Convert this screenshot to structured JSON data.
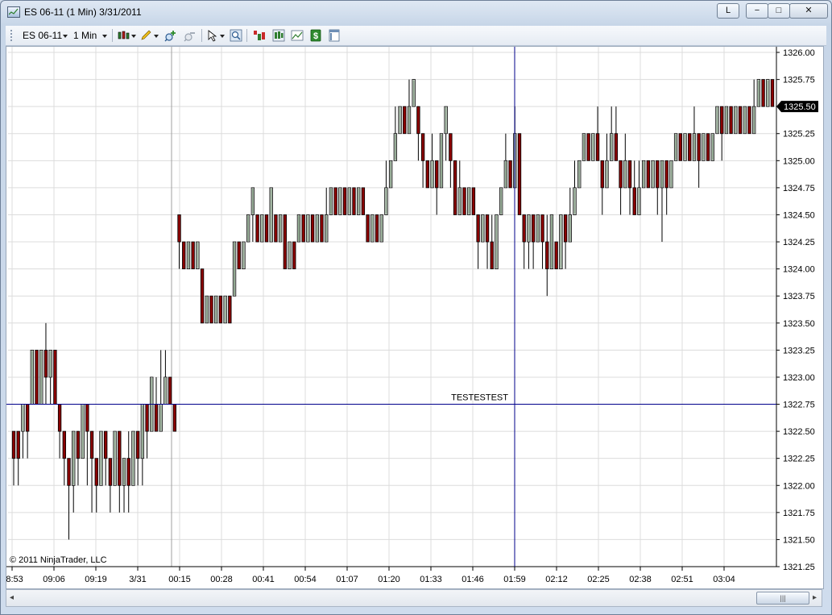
{
  "window": {
    "title": "ES 06-11 (1 Min)  3/31/2011",
    "layout_button": "L",
    "minimize_glyph": "−",
    "maximize_glyph": "□",
    "close_glyph": "✕"
  },
  "toolbar": {
    "instrument": "ES 06-11",
    "interval": "1 Min",
    "icons": [
      "bar-type-icon",
      "pencil-draw-icon",
      "zoom-in-icon",
      "zoom-out-icon",
      "pointer-icon",
      "magnifier-icon",
      "indicators-icon",
      "strategies-icon",
      "chart-style-icon",
      "dollar-icon",
      "properties-icon"
    ]
  },
  "copyright": "© 2011 NinjaTrader, LLC",
  "crosshair_label": "TESTESTEST",
  "price_badge": "1325.50",
  "colors": {
    "up": "#2f5b2f",
    "down": "#8b0000",
    "wick": "#000000",
    "crosshair": "#00008b",
    "grid": "#dcdcdc"
  },
  "scrollbar": {
    "left_arrow": "◂",
    "right_arrow": "▸",
    "thumb_grip": "|||"
  },
  "chart_data": {
    "type": "candlestick",
    "y_ticks": [
      "1326.00",
      "1325.75",
      "1325.50",
      "1325.25",
      "1325.00",
      "1324.75",
      "1324.50",
      "1324.25",
      "1324.00",
      "1323.75",
      "1323.50",
      "1323.25",
      "1323.00",
      "1322.75",
      "1322.50",
      "1322.25",
      "1322.00",
      "1321.75",
      "1321.50",
      "1321.25"
    ],
    "ylim": [
      1321.25,
      1326.0
    ],
    "x_ticks": [
      "08:53",
      "09:06",
      "09:19",
      "3/31",
      "00:15",
      "00:28",
      "00:41",
      "00:54",
      "01:07",
      "01:20",
      "01:33",
      "01:46",
      "01:59",
      "02:12",
      "02:25",
      "02:38",
      "02:51",
      "03:04"
    ],
    "crosshair": {
      "x_time": "01:59",
      "y_price": 1322.75
    },
    "last_price": 1325.5,
    "bars": [
      [
        1322.5,
        1322.25,
        1322.5,
        1322.0
      ],
      [
        1322.5,
        1322.25,
        1322.5,
        1322.0
      ],
      [
        1322.5,
        1322.75,
        1322.75,
        1322.25
      ],
      [
        1322.75,
        1322.5,
        1322.75,
        1322.25
      ],
      [
        1322.75,
        1323.25,
        1323.25,
        1322.75
      ],
      [
        1323.25,
        1322.75,
        1323.25,
        1322.75
      ],
      [
        1322.75,
        1323.25,
        1323.25,
        1322.75
      ],
      [
        1323.25,
        1323.0,
        1323.5,
        1322.75
      ],
      [
        1323.0,
        1323.25,
        1323.25,
        1322.75
      ],
      [
        1323.25,
        1322.75,
        1323.25,
        1322.75
      ],
      [
        1322.75,
        1322.5,
        1322.75,
        1322.25
      ],
      [
        1322.5,
        1322.25,
        1322.5,
        1322.0
      ],
      [
        1322.25,
        1322.0,
        1322.25,
        1321.5
      ],
      [
        1322.0,
        1322.5,
        1322.5,
        1321.75
      ],
      [
        1322.5,
        1322.25,
        1322.5,
        1322.0
      ],
      [
        1322.25,
        1322.75,
        1322.75,
        1322.25
      ],
      [
        1322.75,
        1322.5,
        1322.75,
        1322.0
      ],
      [
        1322.5,
        1322.25,
        1322.5,
        1321.75
      ],
      [
        1322.25,
        1322.0,
        1322.25,
        1321.75
      ],
      [
        1322.0,
        1322.5,
        1322.5,
        1322.0
      ],
      [
        1322.5,
        1322.25,
        1322.5,
        1322.0
      ],
      [
        1322.25,
        1322.0,
        1322.25,
        1321.75
      ],
      [
        1322.0,
        1322.5,
        1322.5,
        1322.0
      ],
      [
        1322.5,
        1322.0,
        1322.5,
        1321.75
      ],
      [
        1322.0,
        1322.25,
        1322.25,
        1321.75
      ],
      [
        1322.25,
        1322.0,
        1322.5,
        1321.75
      ],
      [
        1322.0,
        1322.5,
        1322.5,
        1322.0
      ],
      [
        1322.5,
        1322.25,
        1322.5,
        1322.0
      ],
      [
        1322.25,
        1322.75,
        1322.75,
        1322.0
      ],
      [
        1322.75,
        1322.5,
        1322.75,
        1322.25
      ],
      [
        1322.5,
        1323.0,
        1323.0,
        1322.5
      ],
      [
        1322.75,
        1322.5,
        1323.0,
        1322.5
      ],
      [
        1322.5,
        1322.75,
        1323.25,
        1322.5
      ],
      [
        1322.75,
        1323.0,
        1323.25,
        1322.75
      ],
      [
        1323.0,
        1322.75,
        1323.0,
        1322.75
      ],
      [
        1322.75,
        1322.5,
        1322.75,
        1322.5
      ],
      [
        1324.5,
        1324.25,
        1324.5,
        1324.0
      ],
      [
        1324.25,
        1324.0,
        1324.25,
        1324.0
      ],
      [
        1324.0,
        1324.25,
        1324.25,
        1324.0
      ],
      [
        1324.25,
        1324.0,
        1324.25,
        1324.0
      ],
      [
        1324.0,
        1324.25,
        1324.25,
        1324.0
      ],
      [
        1324.0,
        1323.5,
        1324.0,
        1323.5
      ],
      [
        1323.5,
        1323.75,
        1323.75,
        1323.5
      ],
      [
        1323.75,
        1323.5,
        1323.75,
        1323.5
      ],
      [
        1323.5,
        1323.75,
        1323.75,
        1323.5
      ],
      [
        1323.75,
        1323.5,
        1323.75,
        1323.5
      ],
      [
        1323.5,
        1323.75,
        1323.75,
        1323.5
      ],
      [
        1323.75,
        1323.5,
        1323.75,
        1323.5
      ],
      [
        1323.75,
        1324.25,
        1324.25,
        1323.75
      ],
      [
        1324.25,
        1324.0,
        1324.25,
        1324.0
      ],
      [
        1324.0,
        1324.25,
        1324.25,
        1324.0
      ],
      [
        1324.25,
        1324.5,
        1324.5,
        1324.25
      ],
      [
        1324.5,
        1324.75,
        1324.75,
        1324.25
      ],
      [
        1324.5,
        1324.25,
        1324.5,
        1324.25
      ],
      [
        1324.25,
        1324.5,
        1324.5,
        1324.25
      ],
      [
        1324.5,
        1324.25,
        1324.5,
        1324.25
      ],
      [
        1324.25,
        1324.75,
        1324.75,
        1324.25
      ],
      [
        1324.5,
        1324.25,
        1324.5,
        1324.25
      ],
      [
        1324.25,
        1324.5,
        1324.5,
        1324.25
      ],
      [
        1324.5,
        1324.0,
        1324.5,
        1324.0
      ],
      [
        1324.0,
        1324.25,
        1324.25,
        1324.0
      ],
      [
        1324.25,
        1324.0,
        1324.25,
        1324.0
      ],
      [
        1324.25,
        1324.5,
        1324.5,
        1324.25
      ],
      [
        1324.5,
        1324.25,
        1324.5,
        1324.25
      ],
      [
        1324.25,
        1324.5,
        1324.5,
        1324.25
      ],
      [
        1324.5,
        1324.25,
        1324.5,
        1324.25
      ],
      [
        1324.25,
        1324.5,
        1324.5,
        1324.25
      ],
      [
        1324.5,
        1324.25,
        1324.5,
        1324.25
      ],
      [
        1324.25,
        1324.5,
        1324.75,
        1324.25
      ],
      [
        1324.5,
        1324.75,
        1324.75,
        1324.5
      ],
      [
        1324.75,
        1324.5,
        1324.75,
        1324.5
      ],
      [
        1324.5,
        1324.75,
        1324.75,
        1324.5
      ],
      [
        1324.75,
        1324.5,
        1324.75,
        1324.5
      ],
      [
        1324.5,
        1324.75,
        1324.75,
        1324.5
      ],
      [
        1324.75,
        1324.5,
        1324.75,
        1324.5
      ],
      [
        1324.5,
        1324.75,
        1324.75,
        1324.5
      ],
      [
        1324.75,
        1324.5,
        1324.75,
        1324.5
      ],
      [
        1324.5,
        1324.25,
        1324.5,
        1324.25
      ],
      [
        1324.25,
        1324.5,
        1324.5,
        1324.25
      ],
      [
        1324.5,
        1324.25,
        1324.5,
        1324.25
      ],
      [
        1324.25,
        1324.5,
        1324.5,
        1324.25
      ],
      [
        1324.5,
        1324.75,
        1325.0,
        1324.5
      ],
      [
        1324.75,
        1325.0,
        1325.0,
        1324.75
      ],
      [
        1325.0,
        1325.25,
        1325.5,
        1325.0
      ],
      [
        1325.25,
        1325.5,
        1325.5,
        1325.25
      ],
      [
        1325.5,
        1325.25,
        1325.5,
        1325.25
      ],
      [
        1325.25,
        1325.5,
        1325.75,
        1325.25
      ],
      [
        1325.5,
        1325.75,
        1325.75,
        1325.5
      ],
      [
        1325.5,
        1325.25,
        1325.5,
        1325.0
      ],
      [
        1325.25,
        1325.0,
        1325.25,
        1324.75
      ],
      [
        1325.0,
        1324.75,
        1325.0,
        1324.75
      ],
      [
        1324.75,
        1325.0,
        1325.25,
        1324.75
      ],
      [
        1325.0,
        1324.75,
        1325.0,
        1324.5
      ],
      [
        1324.75,
        1325.25,
        1325.25,
        1324.75
      ],
      [
        1325.25,
        1325.5,
        1325.5,
        1325.0
      ],
      [
        1325.25,
        1325.0,
        1325.25,
        1324.75
      ],
      [
        1325.0,
        1324.5,
        1325.0,
        1324.5
      ],
      [
        1324.5,
        1324.75,
        1325.0,
        1324.5
      ],
      [
        1324.75,
        1324.5,
        1324.75,
        1324.5
      ],
      [
        1324.5,
        1324.75,
        1324.75,
        1324.5
      ],
      [
        1324.75,
        1324.5,
        1324.75,
        1324.5
      ],
      [
        1324.5,
        1324.25,
        1324.5,
        1324.0
      ],
      [
        1324.25,
        1324.5,
        1324.5,
        1324.25
      ],
      [
        1324.5,
        1324.25,
        1324.5,
        1324.0
      ],
      [
        1324.25,
        1324.0,
        1324.5,
        1324.0
      ],
      [
        1324.0,
        1324.5,
        1324.5,
        1324.0
      ],
      [
        1324.5,
        1324.75,
        1324.75,
        1324.5
      ],
      [
        1324.75,
        1325.0,
        1325.25,
        1324.75
      ],
      [
        1325.0,
        1324.75,
        1325.0,
        1324.75
      ],
      [
        1324.75,
        1325.25,
        1325.5,
        1324.75
      ],
      [
        1325.25,
        1324.5,
        1325.25,
        1324.5
      ],
      [
        1324.5,
        1324.25,
        1324.5,
        1324.0
      ],
      [
        1324.25,
        1324.5,
        1324.5,
        1324.0
      ],
      [
        1324.5,
        1324.25,
        1324.5,
        1324.0
      ],
      [
        1324.25,
        1324.5,
        1324.5,
        1324.25
      ],
      [
        1324.5,
        1324.25,
        1324.5,
        1324.0
      ],
      [
        1324.25,
        1324.0,
        1324.5,
        1323.75
      ],
      [
        1324.0,
        1324.5,
        1324.5,
        1324.0
      ],
      [
        1324.25,
        1324.0,
        1324.25,
        1324.0
      ],
      [
        1324.0,
        1324.5,
        1324.5,
        1324.0
      ],
      [
        1324.5,
        1324.25,
        1324.5,
        1324.0
      ],
      [
        1324.25,
        1324.5,
        1324.75,
        1324.25
      ],
      [
        1324.5,
        1324.75,
        1325.0,
        1324.5
      ],
      [
        1324.75,
        1325.0,
        1325.0,
        1324.75
      ],
      [
        1325.0,
        1325.25,
        1325.25,
        1325.0
      ],
      [
        1325.25,
        1325.0,
        1325.25,
        1325.0
      ],
      [
        1325.0,
        1325.25,
        1325.25,
        1325.0
      ],
      [
        1325.25,
        1325.0,
        1325.5,
        1325.0
      ],
      [
        1325.0,
        1324.75,
        1325.0,
        1324.5
      ],
      [
        1324.75,
        1325.0,
        1325.25,
        1324.75
      ],
      [
        1325.0,
        1325.25,
        1325.5,
        1325.0
      ],
      [
        1325.25,
        1325.0,
        1325.5,
        1325.0
      ],
      [
        1325.0,
        1324.75,
        1325.0,
        1324.5
      ],
      [
        1324.75,
        1325.0,
        1325.25,
        1324.75
      ],
      [
        1325.0,
        1324.75,
        1325.0,
        1324.5
      ],
      [
        1324.75,
        1324.5,
        1325.0,
        1324.5
      ],
      [
        1324.5,
        1324.75,
        1325.0,
        1324.5
      ],
      [
        1324.75,
        1325.0,
        1325.0,
        1324.75
      ],
      [
        1325.0,
        1324.75,
        1325.0,
        1324.75
      ],
      [
        1324.75,
        1325.0,
        1325.0,
        1324.75
      ],
      [
        1325.0,
        1324.75,
        1325.0,
        1324.5
      ],
      [
        1324.75,
        1325.0,
        1325.0,
        1324.25
      ],
      [
        1325.0,
        1324.75,
        1325.0,
        1324.5
      ],
      [
        1324.75,
        1325.0,
        1325.0,
        1324.75
      ],
      [
        1325.0,
        1325.25,
        1325.25,
        1325.0
      ],
      [
        1325.25,
        1325.0,
        1325.25,
        1325.0
      ],
      [
        1325.0,
        1325.25,
        1325.25,
        1325.0
      ],
      [
        1325.25,
        1325.0,
        1325.25,
        1325.0
      ],
      [
        1325.0,
        1325.25,
        1325.5,
        1325.0
      ],
      [
        1325.25,
        1325.0,
        1325.25,
        1324.75
      ],
      [
        1325.0,
        1325.25,
        1325.25,
        1325.0
      ],
      [
        1325.25,
        1325.0,
        1325.25,
        1325.0
      ],
      [
        1325.0,
        1325.25,
        1325.25,
        1325.0
      ],
      [
        1325.25,
        1325.5,
        1325.5,
        1325.25
      ],
      [
        1325.5,
        1325.25,
        1325.5,
        1325.0
      ],
      [
        1325.25,
        1325.5,
        1325.5,
        1325.25
      ],
      [
        1325.5,
        1325.25,
        1325.5,
        1325.25
      ],
      [
        1325.25,
        1325.5,
        1325.5,
        1325.25
      ],
      [
        1325.5,
        1325.25,
        1325.5,
        1325.25
      ],
      [
        1325.25,
        1325.5,
        1325.5,
        1325.25
      ],
      [
        1325.5,
        1325.25,
        1325.5,
        1325.25
      ],
      [
        1325.25,
        1325.5,
        1325.75,
        1325.25
      ],
      [
        1325.5,
        1325.75,
        1325.75,
        1325.5
      ],
      [
        1325.75,
        1325.5,
        1325.75,
        1325.5
      ],
      [
        1325.5,
        1325.75,
        1325.75,
        1325.5
      ],
      [
        1325.75,
        1325.5,
        1325.75,
        1325.5
      ]
    ]
  }
}
